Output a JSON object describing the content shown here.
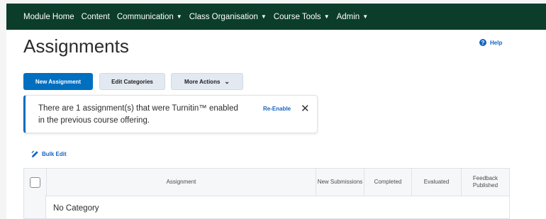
{
  "nav": {
    "items": [
      {
        "label": "Module Home",
        "has_dropdown": false
      },
      {
        "label": "Content",
        "has_dropdown": false
      },
      {
        "label": "Communication",
        "has_dropdown": true
      },
      {
        "label": "Class Organisation",
        "has_dropdown": true
      },
      {
        "label": "Course Tools",
        "has_dropdown": true
      },
      {
        "label": "Admin",
        "has_dropdown": true
      }
    ]
  },
  "page": {
    "title": "Assignments",
    "help_label": "Help"
  },
  "toolbar": {
    "new_assignment": "New Assignment",
    "edit_categories": "Edit Categories",
    "more_actions": "More Actions"
  },
  "alert": {
    "message": "There are 1 assignment(s) that were Turnitin™ enabled in the previous course offering.",
    "action": "Re-Enable"
  },
  "bulk_edit": {
    "label": "Bulk Edit"
  },
  "table": {
    "headers": {
      "assignment": "Assignment",
      "new_submissions": "New Submissions",
      "completed": "Completed",
      "evaluated": "Evaluated",
      "feedback_published": "Feedback Published"
    },
    "category": "No Category"
  },
  "colors": {
    "navbar": "#0b3d2a",
    "primary": "#006fbf",
    "link": "#1565c0"
  },
  "icons": {
    "help": "help-circle-icon",
    "close": "close-icon",
    "bulk_edit": "pencil-icon",
    "dropdown": "chevron-down-icon"
  }
}
